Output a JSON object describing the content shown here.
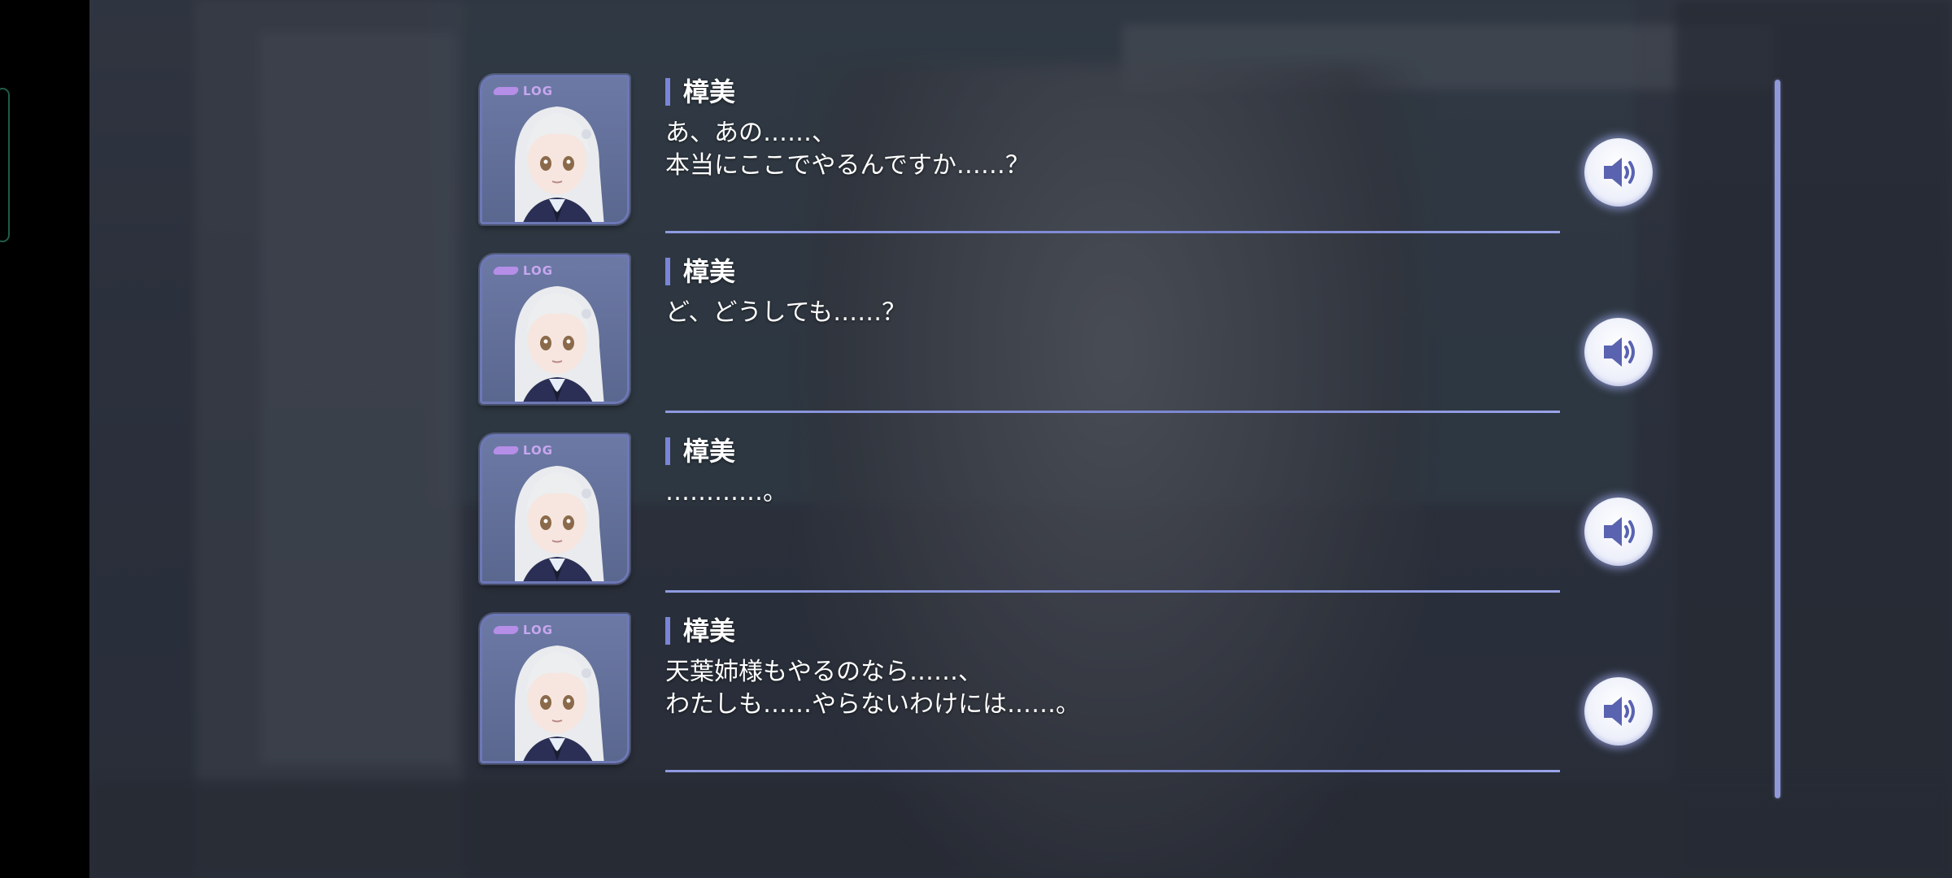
{
  "log": {
    "entries": [
      {
        "log_tag": "LOG",
        "speaker": "樟美",
        "lines": [
          "あ、あの……、",
          "本当にここでやるんですか……？"
        ]
      },
      {
        "log_tag": "LOG",
        "speaker": "樟美",
        "lines": [
          "ど、どうしても……？"
        ]
      },
      {
        "log_tag": "LOG",
        "speaker": "樟美",
        "lines": [
          "…………。"
        ]
      },
      {
        "log_tag": "LOG",
        "speaker": "樟美",
        "lines": [
          "天葉姉様もやるのなら……、",
          "わたしも……やらないわけには……。"
        ]
      }
    ]
  },
  "icons": {
    "voice_button": "speaker-icon",
    "portrait": "character-portrait"
  },
  "colors": {
    "accent": "#7a85d6",
    "portrait_frame": "#6d78b6",
    "log_tag": "#c7a7f0",
    "text": "#ffffff"
  }
}
